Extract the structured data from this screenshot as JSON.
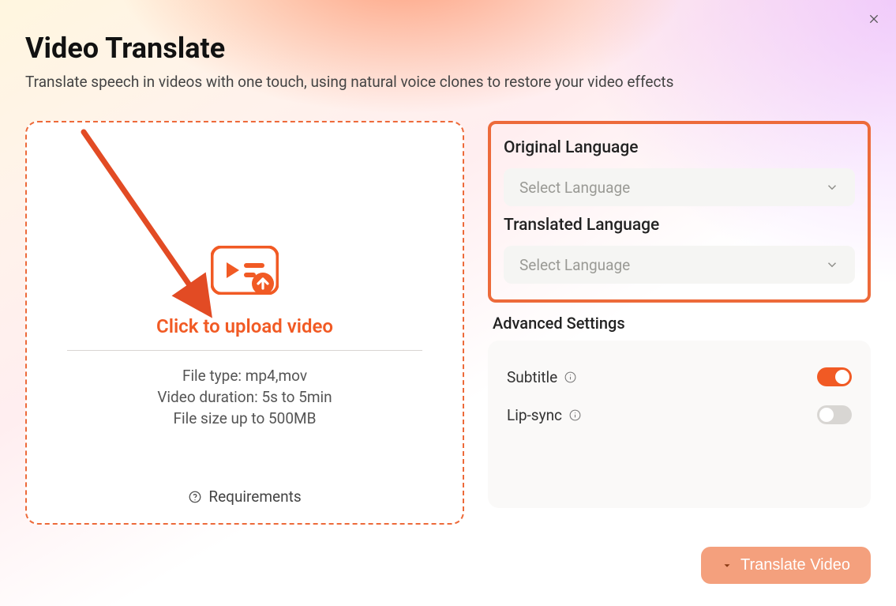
{
  "header": {
    "title": "Video Translate",
    "subtitle": "Translate speech in videos with one touch, using natural voice clones to restore your video effects"
  },
  "upload": {
    "cta": "Click to upload video",
    "file_type": "File type: mp4,mov",
    "duration": "Video duration: 5s to 5min",
    "size": "File size up to  500MB",
    "requirements": "Requirements"
  },
  "langs": {
    "original_label": "Original Language",
    "original_placeholder": "Select Language",
    "translated_label": "Translated Language",
    "translated_placeholder": "Select Language"
  },
  "advanced": {
    "label": "Advanced Settings",
    "subtitle": "Subtitle",
    "lipsync": "Lip-sync",
    "subtitle_on": true,
    "lipsync_on": false
  },
  "footer": {
    "translate_btn": "Translate Video"
  },
  "icons": {
    "close": "close-icon",
    "upload": "upload-video-icon",
    "help": "help-circle-icon",
    "chevron_down": "chevron-down-icon",
    "info": "info-circle-icon"
  },
  "colors": {
    "accent": "#f15a24",
    "highlight_border": "#ed6a3a"
  }
}
